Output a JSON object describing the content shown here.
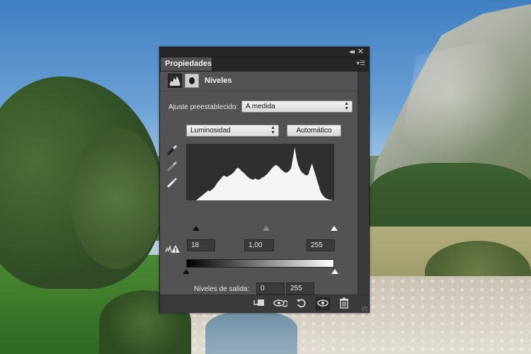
{
  "panel": {
    "tab_label": "Propiedades",
    "title": "Niveles",
    "preset_label": "Ajuste preestablecido:",
    "preset_value": "A medida",
    "channel_value": "Luminosidad",
    "auto_label": "Automático",
    "input_black": "18",
    "input_gamma": "1,00",
    "input_white": "255",
    "output_label": "Niveles de salida:",
    "output_black": "0",
    "output_white": "255"
  },
  "histogram_profile": [
    0,
    2,
    4,
    6,
    8,
    10,
    12,
    14,
    13,
    15,
    17,
    20,
    24,
    27,
    30,
    33,
    35,
    34,
    33,
    35,
    36,
    38,
    40,
    44,
    46,
    45,
    42,
    40,
    38,
    35,
    33,
    31,
    30,
    29,
    31,
    30,
    29,
    30,
    32,
    33,
    35,
    37,
    40,
    43,
    46,
    48,
    50,
    49,
    47,
    44,
    42,
    40,
    39,
    40,
    42,
    46,
    60,
    75,
    60,
    50,
    44,
    40,
    38,
    36,
    35,
    37,
    45,
    52,
    44,
    36,
    28,
    20,
    12,
    8,
    5,
    3,
    2,
    1,
    1,
    0
  ],
  "icons": {
    "collapse": "double-chevron-icon",
    "close": "close-icon",
    "panel_menu": "panel-menu-icon",
    "levels": "levels-adjustment-icon",
    "mask": "layer-mask-icon",
    "black_eyedropper": "black-eyedropper-icon",
    "gray_eyedropper": "gray-eyedropper-icon",
    "white_eyedropper": "white-eyedropper-icon",
    "clip_warning": "clipping-warning-icon",
    "clip_to_layer": "clip-to-layer-icon",
    "view_previous": "view-previous-state-icon",
    "reset": "reset-icon",
    "visibility": "eye-icon",
    "delete": "trash-icon"
  }
}
